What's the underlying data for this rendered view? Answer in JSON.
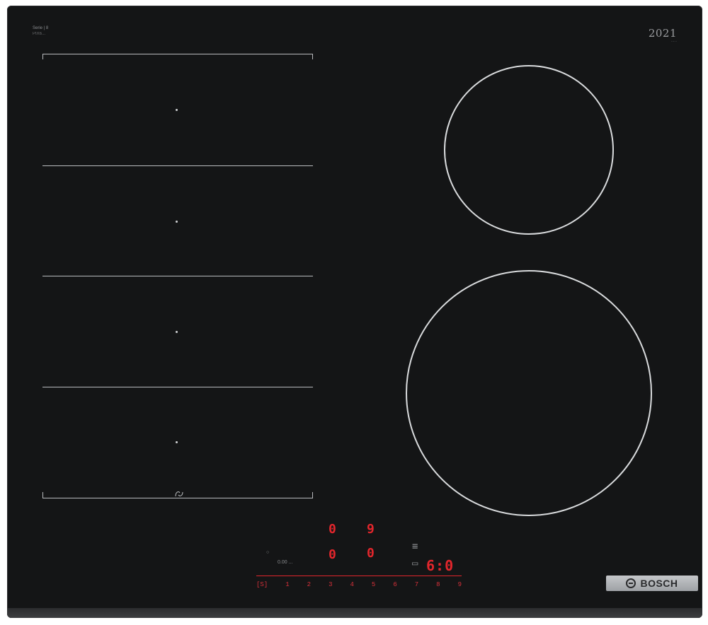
{
  "product": {
    "model_line": "Serie | 8",
    "model_sub": "PIX6...",
    "brand_text": "BOSCH",
    "badge_mark": "2021"
  },
  "flex_zone": {
    "sections": 4,
    "bottom_icon": "flex-link-icon"
  },
  "zones": [
    {
      "name": "rear-right-zone"
    },
    {
      "name": "front-right-zone"
    }
  ],
  "control_panel": {
    "zone_indicators": [
      "0",
      "9",
      "0",
      "0"
    ],
    "timer": "6:0",
    "mode_text": "0.00  ...",
    "scale": [
      "[S]",
      "1",
      "2",
      "3",
      "4",
      "5",
      "6",
      "7",
      "8",
      "9"
    ]
  },
  "colors": {
    "hob": "#141516",
    "lines": "#b9bbbe",
    "display": "#e3262c",
    "badge": "#b4b6b9"
  }
}
